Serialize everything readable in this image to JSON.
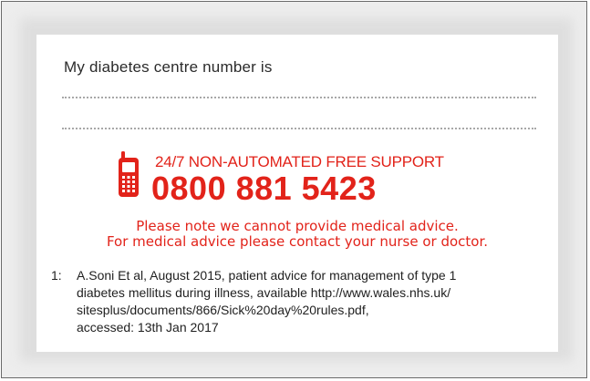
{
  "card": {
    "title": "My diabetes centre number is"
  },
  "support": {
    "label": "24/7 NON-AUTOMATED FREE SUPPORT",
    "number": "0800 881 5423",
    "icon": "mobile-phone-icon",
    "color": "#e2231a"
  },
  "notice": {
    "line1": "Please note we cannot provide medical advice.",
    "line2": "For medical advice please contact your nurse or doctor."
  },
  "footnote": {
    "number": "1:",
    "lines": [
      "A.Soni Et al, August 2015, patient advice for management of type 1",
      "diabetes mellitus during illness, available http://www.wales.nhs.uk/",
      "sitesplus/documents/866/Sick%20day%20rules.pdf,",
      "accessed: 13th Jan 2017"
    ]
  }
}
